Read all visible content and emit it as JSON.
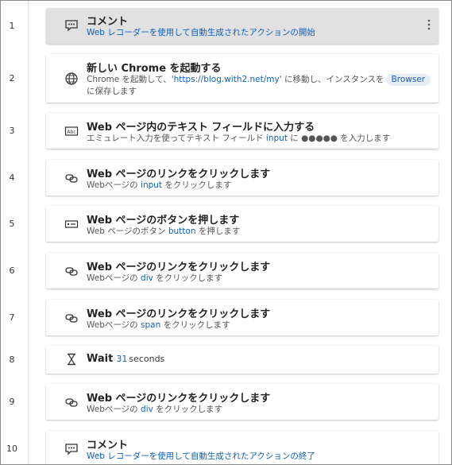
{
  "steps": [
    {
      "num": "1",
      "title": "コメント",
      "sub": "Web レコーダーを使用して自動生成されたアクションの開始",
      "icon": "comment-icon"
    },
    {
      "num": "2",
      "title": "新しい Chrome を起動する",
      "sub_pre": "Chrome を起動して、",
      "sub_url": "'https://blog.with2.net/my'",
      "sub_mid": " に移動し、インスタンスを",
      "sub_badge": "Browser",
      "sub_line2": "に保存します",
      "icon": "globe-icon"
    },
    {
      "num": "3",
      "title": "Web ページ内のテキスト フィールドに入力する",
      "sub_pre": "エミュレート入力を使ってテキスト フィールド ",
      "sub_var": "input",
      "sub_mid": " に ",
      "sub_mask": "●●●●●",
      "sub_post": " を入力します",
      "icon": "textbox-icon"
    },
    {
      "num": "4",
      "title": "Web ページのリンクをクリックします",
      "sub_pre": "Webページの ",
      "sub_var": "input",
      "sub_post": " をクリックします",
      "icon": "link-icon"
    },
    {
      "num": "5",
      "title": "Web ページのボタンを押します",
      "sub_pre": "Web ページのボタン ",
      "sub_var": "button",
      "sub_post": " を押します",
      "icon": "button-icon"
    },
    {
      "num": "6",
      "title": "Web ページのリンクをクリックします",
      "sub_pre": "Webページの ",
      "sub_var": "div",
      "sub_post": " をクリックします",
      "icon": "link-icon"
    },
    {
      "num": "7",
      "title": "Web ページのリンクをクリックします",
      "sub_pre": "Webページの ",
      "sub_var": "span",
      "sub_post": " をクリックします",
      "icon": "link-icon"
    },
    {
      "num": "8",
      "title": "Wait",
      "wait_value": "31",
      "wait_unit": "seconds",
      "icon": "hourglass-icon"
    },
    {
      "num": "9",
      "title": "Web ページのリンクをクリックします",
      "sub_pre": "Webページの ",
      "sub_var": "div",
      "sub_post": " をクリックします",
      "icon": "link-icon"
    },
    {
      "num": "10",
      "title": "コメント",
      "sub": "Web レコーダーを使用して自動生成されたアクションの終了",
      "icon": "comment-icon"
    }
  ],
  "colors": {
    "accent": "#0f5fbf",
    "selected_bg": "#e1e1e1"
  },
  "more_icon": "more-vertical-icon"
}
